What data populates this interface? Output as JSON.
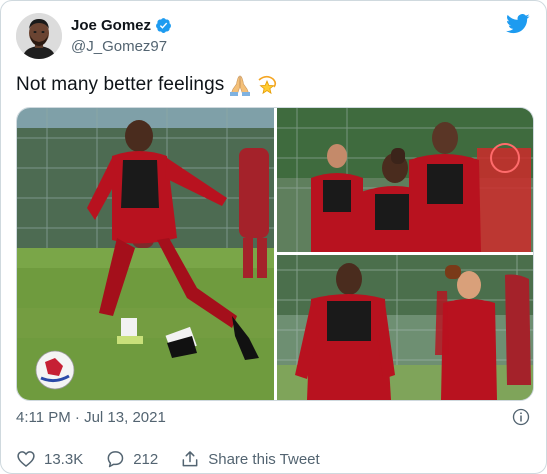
{
  "user": {
    "display_name": "Joe Gomez",
    "handle": "@J_Gomez97",
    "verified_icon": "verified-badge-icon",
    "avatar_icon": "profile-avatar-icon"
  },
  "tweet": {
    "text": "Not many better feelings",
    "emojis": [
      "folded-hands-emoji",
      "dizzy-star-emoji"
    ],
    "timestamp": "4:11 PM · Jul 13, 2021"
  },
  "media": [
    {
      "name": "training-photo-ball"
    },
    {
      "name": "training-photo-group"
    },
    {
      "name": "training-photo-closeup"
    }
  ],
  "actions": {
    "likes": "13.3K",
    "replies": "212",
    "share_label": "Share this Tweet"
  },
  "colors": {
    "accent": "#1d9bf0",
    "text_secondary": "#536471",
    "kit_red": "#b8121f",
    "grass": "#6f9b3e"
  }
}
